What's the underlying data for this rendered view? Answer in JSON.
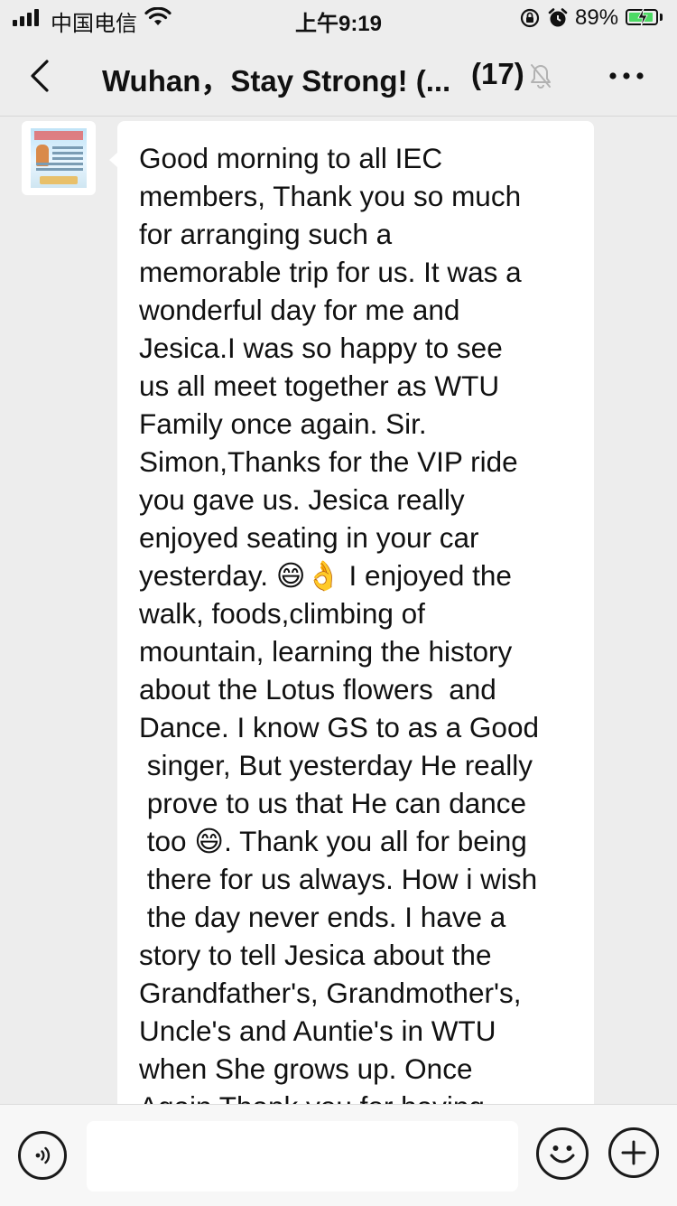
{
  "status_bar": {
    "carrier": "中国电信",
    "time": "上午9:19",
    "battery": "89%"
  },
  "nav": {
    "title": "Wuhan，Stay Strong! (...",
    "member_count": "(17)",
    "icons": [
      "back-icon",
      "mute-bell-icon",
      "more-icon"
    ]
  },
  "message": {
    "text": "Good morning to all IEC\nmembers, Thank you so much\nfor arranging such a\nmemorable trip for us. It was a\nwonderful day for me and\nJesica.I was so happy to see\nus all meet together as WTU\nFamily once again. Sir.\nSimon,Thanks for the VIP ride\nyou gave us. Jesica really\nenjoyed seating in your car\nyesterday. 😄👌 I enjoyed the\nwalk, foods,climbing of\nmountain, learning the history\nabout the Lotus flowers  and\nDance. I know GS to as a Good\n singer, But yesterday He really\n prove to us that He can dance\n too 😄. Thank you all for being\n there for us always. How i wish\n the day never ends. I have a\nstory to tell Jesica about the\nGrandfather's, Grandmother's,\nUncle's and Auntie's in WTU\nwhen She grows up. Once\nAgain Thank you for having"
  },
  "input_bar": {
    "placeholder": "",
    "icons": [
      "voice-icon",
      "emoji-icon",
      "plus-icon"
    ]
  },
  "colors": {
    "background": "#ededed",
    "bubble": "#ffffff",
    "battery_fill": "#4cd964"
  }
}
